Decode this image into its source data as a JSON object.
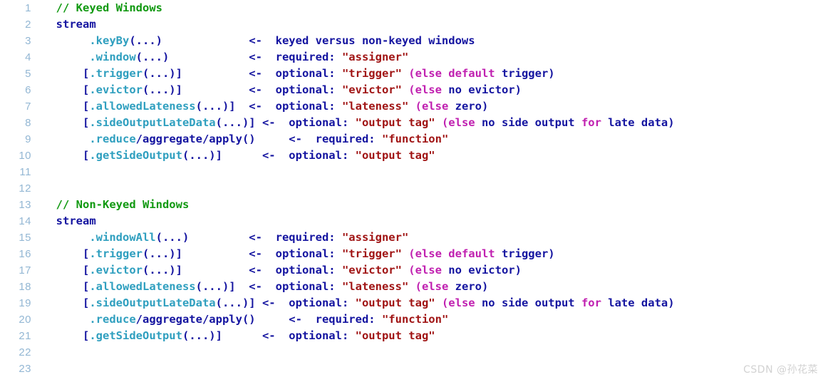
{
  "editor": {
    "language": "java",
    "total_lines": 23,
    "gutter_color": "#93b7d4",
    "background": "#ffffff",
    "colors": {
      "comment": "#119911",
      "plain": "#1414a0",
      "method": "#2f9fbf",
      "string": "#a01414",
      "keyword": "#c020b0"
    }
  },
  "watermark": {
    "text": "CSDN @孙花菜"
  },
  "lines": [
    {
      "number": "1",
      "tokens": [
        {
          "text": "  ",
          "cls": "t-plain"
        },
        {
          "text": "// Keyed Windows",
          "cls": "t-comment"
        }
      ]
    },
    {
      "number": "2",
      "tokens": [
        {
          "text": "  stream",
          "cls": "t-plain"
        }
      ]
    },
    {
      "number": "3",
      "tokens": [
        {
          "text": "       .keyBy",
          "cls": "t-method"
        },
        {
          "text": "(...)",
          "cls": "t-punct"
        },
        {
          "text": "             <-  keyed versus non-keyed windows",
          "cls": "t-plain"
        }
      ]
    },
    {
      "number": "4",
      "tokens": [
        {
          "text": "       .window",
          "cls": "t-method"
        },
        {
          "text": "(...)",
          "cls": "t-punct"
        },
        {
          "text": "            <-  required: ",
          "cls": "t-plain"
        },
        {
          "text": "\"assigner\"",
          "cls": "t-string"
        }
      ]
    },
    {
      "number": "5",
      "tokens": [
        {
          "text": "      [",
          "cls": "t-punct"
        },
        {
          "text": ".trigger",
          "cls": "t-method"
        },
        {
          "text": "(...)]",
          "cls": "t-punct"
        },
        {
          "text": "          <-  optional: ",
          "cls": "t-plain"
        },
        {
          "text": "\"trigger\"",
          "cls": "t-string"
        },
        {
          "text": " ",
          "cls": "t-plain"
        },
        {
          "text": "(else default",
          "cls": "t-keyword"
        },
        {
          "text": " trigger)",
          "cls": "t-plain"
        }
      ]
    },
    {
      "number": "6",
      "tokens": [
        {
          "text": "      [",
          "cls": "t-punct"
        },
        {
          "text": ".evictor",
          "cls": "t-method"
        },
        {
          "text": "(...)]",
          "cls": "t-punct"
        },
        {
          "text": "          <-  optional: ",
          "cls": "t-plain"
        },
        {
          "text": "\"evictor\"",
          "cls": "t-string"
        },
        {
          "text": " ",
          "cls": "t-plain"
        },
        {
          "text": "(else",
          "cls": "t-keyword"
        },
        {
          "text": " no evictor)",
          "cls": "t-plain"
        }
      ]
    },
    {
      "number": "7",
      "tokens": [
        {
          "text": "      [",
          "cls": "t-punct"
        },
        {
          "text": ".allowedLateness",
          "cls": "t-method"
        },
        {
          "text": "(...)]",
          "cls": "t-punct"
        },
        {
          "text": "  <-  optional: ",
          "cls": "t-plain"
        },
        {
          "text": "\"lateness\"",
          "cls": "t-string"
        },
        {
          "text": " ",
          "cls": "t-plain"
        },
        {
          "text": "(else",
          "cls": "t-keyword"
        },
        {
          "text": " zero)",
          "cls": "t-plain"
        }
      ]
    },
    {
      "number": "8",
      "tokens": [
        {
          "text": "      [",
          "cls": "t-punct"
        },
        {
          "text": ".sideOutputLateData",
          "cls": "t-method"
        },
        {
          "text": "(...)]",
          "cls": "t-punct"
        },
        {
          "text": " <-  optional: ",
          "cls": "t-plain"
        },
        {
          "text": "\"output tag\"",
          "cls": "t-string"
        },
        {
          "text": " ",
          "cls": "t-plain"
        },
        {
          "text": "(else",
          "cls": "t-keyword"
        },
        {
          "text": " no side output ",
          "cls": "t-plain"
        },
        {
          "text": "for",
          "cls": "t-keyword"
        },
        {
          "text": " late data)",
          "cls": "t-plain"
        }
      ]
    },
    {
      "number": "9",
      "tokens": [
        {
          "text": "       .reduce",
          "cls": "t-method"
        },
        {
          "text": "/aggregate/apply()",
          "cls": "t-plain"
        },
        {
          "text": "     <-  required: ",
          "cls": "t-plain"
        },
        {
          "text": "\"function\"",
          "cls": "t-string"
        }
      ]
    },
    {
      "number": "10",
      "tokens": [
        {
          "text": "      [",
          "cls": "t-punct"
        },
        {
          "text": ".getSideOutput",
          "cls": "t-method"
        },
        {
          "text": "(...)]",
          "cls": "t-punct"
        },
        {
          "text": "      <-  optional: ",
          "cls": "t-plain"
        },
        {
          "text": "\"output tag\"",
          "cls": "t-string"
        }
      ]
    },
    {
      "number": "11",
      "tokens": []
    },
    {
      "number": "12",
      "tokens": []
    },
    {
      "number": "13",
      "tokens": [
        {
          "text": "  ",
          "cls": "t-plain"
        },
        {
          "text": "// Non-Keyed Windows",
          "cls": "t-comment"
        }
      ]
    },
    {
      "number": "14",
      "tokens": [
        {
          "text": "  stream",
          "cls": "t-plain"
        }
      ]
    },
    {
      "number": "15",
      "tokens": [
        {
          "text": "       .windowAll",
          "cls": "t-method"
        },
        {
          "text": "(...)",
          "cls": "t-punct"
        },
        {
          "text": "         <-  required: ",
          "cls": "t-plain"
        },
        {
          "text": "\"assigner\"",
          "cls": "t-string"
        }
      ]
    },
    {
      "number": "16",
      "tokens": [
        {
          "text": "      [",
          "cls": "t-punct"
        },
        {
          "text": ".trigger",
          "cls": "t-method"
        },
        {
          "text": "(...)]",
          "cls": "t-punct"
        },
        {
          "text": "          <-  optional: ",
          "cls": "t-plain"
        },
        {
          "text": "\"trigger\"",
          "cls": "t-string"
        },
        {
          "text": " ",
          "cls": "t-plain"
        },
        {
          "text": "(else default",
          "cls": "t-keyword"
        },
        {
          "text": " trigger)",
          "cls": "t-plain"
        }
      ]
    },
    {
      "number": "17",
      "tokens": [
        {
          "text": "      [",
          "cls": "t-punct"
        },
        {
          "text": ".evictor",
          "cls": "t-method"
        },
        {
          "text": "(...)]",
          "cls": "t-punct"
        },
        {
          "text": "          <-  optional: ",
          "cls": "t-plain"
        },
        {
          "text": "\"evictor\"",
          "cls": "t-string"
        },
        {
          "text": " ",
          "cls": "t-plain"
        },
        {
          "text": "(else",
          "cls": "t-keyword"
        },
        {
          "text": " no evictor)",
          "cls": "t-plain"
        }
      ]
    },
    {
      "number": "18",
      "tokens": [
        {
          "text": "      [",
          "cls": "t-punct"
        },
        {
          "text": ".allowedLateness",
          "cls": "t-method"
        },
        {
          "text": "(...)]",
          "cls": "t-punct"
        },
        {
          "text": "  <-  optional: ",
          "cls": "t-plain"
        },
        {
          "text": "\"lateness\"",
          "cls": "t-string"
        },
        {
          "text": " ",
          "cls": "t-plain"
        },
        {
          "text": "(else",
          "cls": "t-keyword"
        },
        {
          "text": " zero)",
          "cls": "t-plain"
        }
      ]
    },
    {
      "number": "19",
      "tokens": [
        {
          "text": "      [",
          "cls": "t-punct"
        },
        {
          "text": ".sideOutputLateData",
          "cls": "t-method"
        },
        {
          "text": "(...)]",
          "cls": "t-punct"
        },
        {
          "text": " <-  optional: ",
          "cls": "t-plain"
        },
        {
          "text": "\"output tag\"",
          "cls": "t-string"
        },
        {
          "text": " ",
          "cls": "t-plain"
        },
        {
          "text": "(else",
          "cls": "t-keyword"
        },
        {
          "text": " no side output ",
          "cls": "t-plain"
        },
        {
          "text": "for",
          "cls": "t-keyword"
        },
        {
          "text": " late data)",
          "cls": "t-plain"
        }
      ]
    },
    {
      "number": "20",
      "tokens": [
        {
          "text": "       .reduce",
          "cls": "t-method"
        },
        {
          "text": "/aggregate/apply()",
          "cls": "t-plain"
        },
        {
          "text": "     <-  required: ",
          "cls": "t-plain"
        },
        {
          "text": "\"function\"",
          "cls": "t-string"
        }
      ]
    },
    {
      "number": "21",
      "tokens": [
        {
          "text": "      [",
          "cls": "t-punct"
        },
        {
          "text": ".getSideOutput",
          "cls": "t-method"
        },
        {
          "text": "(...)]",
          "cls": "t-punct"
        },
        {
          "text": "      <-  optional: ",
          "cls": "t-plain"
        },
        {
          "text": "\"output tag\"",
          "cls": "t-string"
        }
      ]
    },
    {
      "number": "22",
      "tokens": []
    },
    {
      "number": "23",
      "tokens": []
    }
  ]
}
